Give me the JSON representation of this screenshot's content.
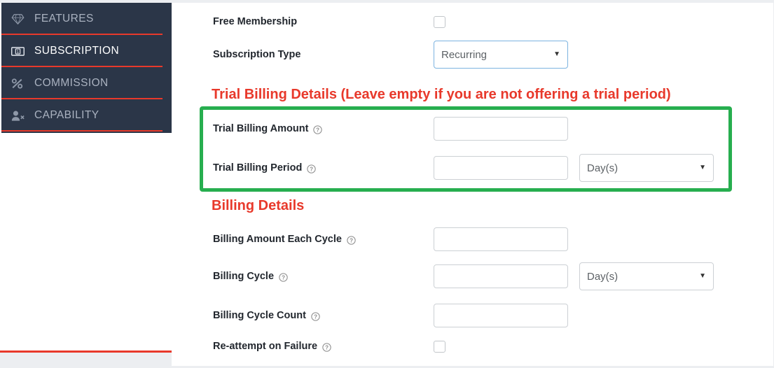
{
  "sidebar": {
    "items": [
      {
        "label": "FEATURES",
        "icon": "gem-icon",
        "active": false,
        "name": "sidebar-item-features"
      },
      {
        "label": "SUBSCRIPTION",
        "icon": "money-bill-icon",
        "active": true,
        "name": "sidebar-item-subscription"
      },
      {
        "label": "COMMISSION",
        "icon": "percent-icon",
        "active": false,
        "name": "sidebar-item-commission"
      },
      {
        "label": "CAPABILITY",
        "icon": "user-times-icon",
        "active": false,
        "name": "sidebar-item-capability"
      }
    ]
  },
  "form": {
    "free_membership": {
      "label": "Free Membership",
      "checked": false
    },
    "subscription_type": {
      "label": "Subscription Type",
      "value": "Recurring",
      "caret": "▼",
      "focused": true
    },
    "trial_section": {
      "heading": "Trial Billing Details (Leave empty if you are not offering a trial period)",
      "highlight_color": "#27ae4f",
      "trial_billing_amount": {
        "label": "Trial Billing Amount",
        "value": "",
        "placeholder": "",
        "help_icon": "question-circle-icon"
      },
      "trial_billing_period": {
        "label": "Trial Billing Period",
        "value": "",
        "placeholder": "",
        "help_icon": "question-circle-icon",
        "unit_value": "Day(s)",
        "caret": "▼"
      }
    },
    "billing_section": {
      "heading": "Billing Details",
      "billing_amount_each_cycle": {
        "label": "Billing Amount Each Cycle",
        "value": "",
        "placeholder": "",
        "help_icon": "question-circle-icon"
      },
      "billing_cycle": {
        "label": "Billing Cycle",
        "value": "",
        "placeholder": "",
        "help_icon": "question-circle-icon",
        "unit_value": "Day(s)",
        "caret": "▼"
      },
      "billing_cycle_count": {
        "label": "Billing Cycle Count",
        "value": "",
        "placeholder": "",
        "help_icon": "question-circle-icon"
      },
      "reattempt_on_failure": {
        "label": "Re-attempt on Failure",
        "checked": false,
        "help_icon": "question-circle-icon"
      }
    }
  },
  "colors": {
    "heading_red": "#e8392b",
    "sidebar_bg": "#2b3648",
    "highlight_green": "#27ae4f",
    "focus_blue": "#7cb3e0"
  }
}
